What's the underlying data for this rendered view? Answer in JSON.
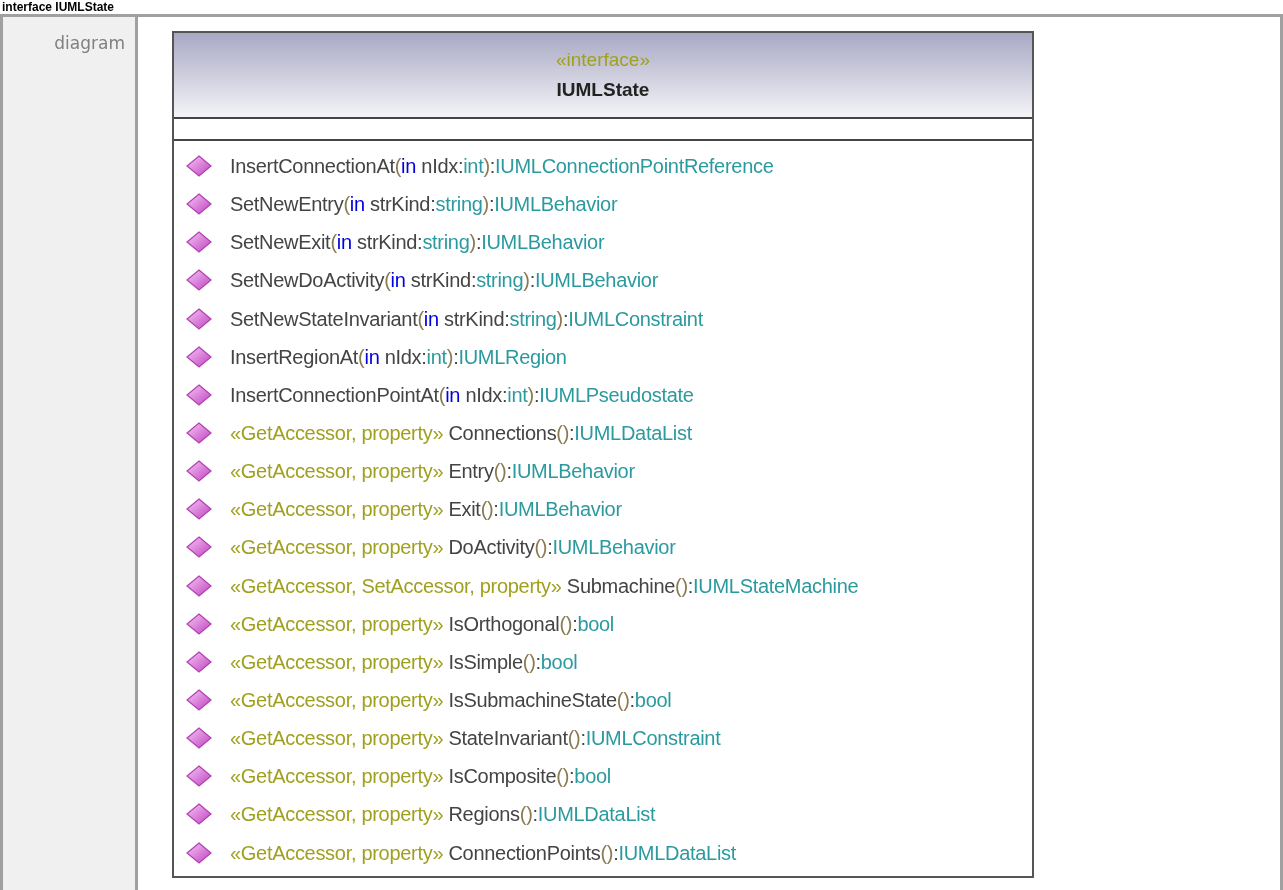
{
  "heading": "interface IUMLState",
  "row_label": "diagram",
  "class_box": {
    "stereotype": "«interface»",
    "name": "IUMLState",
    "operations": [
      [
        {
          "kind": "plain",
          "text": "InsertConnectionAt"
        },
        {
          "kind": "paren",
          "text": "("
        },
        {
          "kind": "keyword",
          "text": "in"
        },
        {
          "kind": "plain",
          "text": " nIdx:"
        },
        {
          "kind": "type",
          "text": "int"
        },
        {
          "kind": "paren",
          "text": ")"
        },
        {
          "kind": "plain",
          "text": ":"
        },
        {
          "kind": "type",
          "text": "IUMLConnectionPointReference"
        }
      ],
      [
        {
          "kind": "plain",
          "text": "SetNewEntry"
        },
        {
          "kind": "paren",
          "text": "("
        },
        {
          "kind": "keyword",
          "text": "in"
        },
        {
          "kind": "plain",
          "text": " strKind:"
        },
        {
          "kind": "type",
          "text": "string"
        },
        {
          "kind": "paren",
          "text": ")"
        },
        {
          "kind": "plain",
          "text": ":"
        },
        {
          "kind": "type",
          "text": "IUMLBehavior"
        }
      ],
      [
        {
          "kind": "plain",
          "text": "SetNewExit"
        },
        {
          "kind": "paren",
          "text": "("
        },
        {
          "kind": "keyword",
          "text": "in"
        },
        {
          "kind": "plain",
          "text": " strKind:"
        },
        {
          "kind": "type",
          "text": "string"
        },
        {
          "kind": "paren",
          "text": ")"
        },
        {
          "kind": "plain",
          "text": ":"
        },
        {
          "kind": "type",
          "text": "IUMLBehavior"
        }
      ],
      [
        {
          "kind": "plain",
          "text": "SetNewDoActivity"
        },
        {
          "kind": "paren",
          "text": "("
        },
        {
          "kind": "keyword",
          "text": "in"
        },
        {
          "kind": "plain",
          "text": " strKind:"
        },
        {
          "kind": "type",
          "text": "string"
        },
        {
          "kind": "paren",
          "text": ")"
        },
        {
          "kind": "plain",
          "text": ":"
        },
        {
          "kind": "type",
          "text": "IUMLBehavior"
        }
      ],
      [
        {
          "kind": "plain",
          "text": "SetNewStateInvariant"
        },
        {
          "kind": "paren",
          "text": "("
        },
        {
          "kind": "keyword",
          "text": "in"
        },
        {
          "kind": "plain",
          "text": " strKind:"
        },
        {
          "kind": "type",
          "text": "string"
        },
        {
          "kind": "paren",
          "text": ")"
        },
        {
          "kind": "plain",
          "text": ":"
        },
        {
          "kind": "type",
          "text": "IUMLConstraint"
        }
      ],
      [
        {
          "kind": "plain",
          "text": "InsertRegionAt"
        },
        {
          "kind": "paren",
          "text": "("
        },
        {
          "kind": "keyword",
          "text": "in"
        },
        {
          "kind": "plain",
          "text": " nIdx:"
        },
        {
          "kind": "type",
          "text": "int"
        },
        {
          "kind": "paren",
          "text": ")"
        },
        {
          "kind": "plain",
          "text": ":"
        },
        {
          "kind": "type",
          "text": "IUMLRegion"
        }
      ],
      [
        {
          "kind": "plain",
          "text": "InsertConnectionPointAt"
        },
        {
          "kind": "paren",
          "text": "("
        },
        {
          "kind": "keyword",
          "text": "in"
        },
        {
          "kind": "plain",
          "text": " nIdx:"
        },
        {
          "kind": "type",
          "text": "int"
        },
        {
          "kind": "paren",
          "text": ")"
        },
        {
          "kind": "plain",
          "text": ":"
        },
        {
          "kind": "type",
          "text": "IUMLPseudostate"
        }
      ],
      [
        {
          "kind": "stereotype",
          "text": "«GetAccessor, property»"
        },
        {
          "kind": "plain",
          "text": " Connections"
        },
        {
          "kind": "paren",
          "text": "()"
        },
        {
          "kind": "plain",
          "text": ":"
        },
        {
          "kind": "type",
          "text": "IUMLDataList"
        }
      ],
      [
        {
          "kind": "stereotype",
          "text": "«GetAccessor, property»"
        },
        {
          "kind": "plain",
          "text": " Entry"
        },
        {
          "kind": "paren",
          "text": "()"
        },
        {
          "kind": "plain",
          "text": ":"
        },
        {
          "kind": "type",
          "text": "IUMLBehavior"
        }
      ],
      [
        {
          "kind": "stereotype",
          "text": "«GetAccessor, property»"
        },
        {
          "kind": "plain",
          "text": " Exit"
        },
        {
          "kind": "paren",
          "text": "()"
        },
        {
          "kind": "plain",
          "text": ":"
        },
        {
          "kind": "type",
          "text": "IUMLBehavior"
        }
      ],
      [
        {
          "kind": "stereotype",
          "text": "«GetAccessor, property»"
        },
        {
          "kind": "plain",
          "text": " DoActivity"
        },
        {
          "kind": "paren",
          "text": "()"
        },
        {
          "kind": "plain",
          "text": ":"
        },
        {
          "kind": "type",
          "text": "IUMLBehavior"
        }
      ],
      [
        {
          "kind": "stereotype",
          "text": "«GetAccessor, SetAccessor, property»"
        },
        {
          "kind": "plain",
          "text": " Submachine"
        },
        {
          "kind": "paren",
          "text": "()"
        },
        {
          "kind": "plain",
          "text": ":"
        },
        {
          "kind": "type",
          "text": "IUMLStateMachine"
        }
      ],
      [
        {
          "kind": "stereotype",
          "text": "«GetAccessor, property»"
        },
        {
          "kind": "plain",
          "text": " IsOrthogonal"
        },
        {
          "kind": "paren",
          "text": "()"
        },
        {
          "kind": "plain",
          "text": ":"
        },
        {
          "kind": "type",
          "text": "bool"
        }
      ],
      [
        {
          "kind": "stereotype",
          "text": "«GetAccessor, property»"
        },
        {
          "kind": "plain",
          "text": " IsSimple"
        },
        {
          "kind": "paren",
          "text": "()"
        },
        {
          "kind": "plain",
          "text": ":"
        },
        {
          "kind": "type",
          "text": "bool"
        }
      ],
      [
        {
          "kind": "stereotype",
          "text": "«GetAccessor, property»"
        },
        {
          "kind": "plain",
          "text": " IsSubmachineState"
        },
        {
          "kind": "paren",
          "text": "()"
        },
        {
          "kind": "plain",
          "text": ":"
        },
        {
          "kind": "type",
          "text": "bool"
        }
      ],
      [
        {
          "kind": "stereotype",
          "text": "«GetAccessor, property»"
        },
        {
          "kind": "plain",
          "text": " StateInvariant"
        },
        {
          "kind": "paren",
          "text": "()"
        },
        {
          "kind": "plain",
          "text": ":"
        },
        {
          "kind": "type",
          "text": "IUMLConstraint"
        }
      ],
      [
        {
          "kind": "stereotype",
          "text": "«GetAccessor, property»"
        },
        {
          "kind": "plain",
          "text": " IsComposite"
        },
        {
          "kind": "paren",
          "text": "()"
        },
        {
          "kind": "plain",
          "text": ":"
        },
        {
          "kind": "type",
          "text": "bool"
        }
      ],
      [
        {
          "kind": "stereotype",
          "text": "«GetAccessor, property»"
        },
        {
          "kind": "plain",
          "text": " Regions"
        },
        {
          "kind": "paren",
          "text": "()"
        },
        {
          "kind": "plain",
          "text": ":"
        },
        {
          "kind": "type",
          "text": "IUMLDataList"
        }
      ],
      [
        {
          "kind": "stereotype",
          "text": "«GetAccessor, property»"
        },
        {
          "kind": "plain",
          "text": " ConnectionPoints"
        },
        {
          "kind": "paren",
          "text": "()"
        },
        {
          "kind": "plain",
          "text": ":"
        },
        {
          "kind": "type",
          "text": "IUMLDataList"
        }
      ]
    ]
  }
}
